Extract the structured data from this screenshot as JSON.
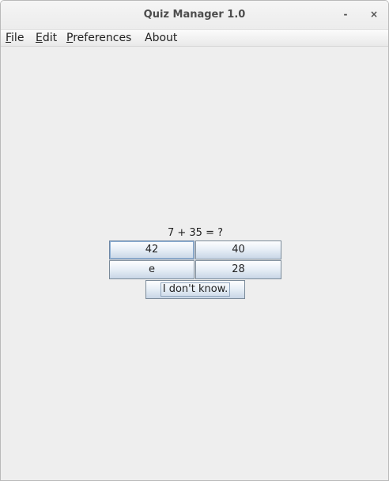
{
  "window": {
    "title": "Quiz Manager 1.0",
    "minimize_label": "-",
    "close_label": "×"
  },
  "menubar": {
    "file": {
      "mnemonic": "F",
      "rest": "ile"
    },
    "edit": {
      "mnemonic": "E",
      "rest": "dit"
    },
    "preferences": {
      "mnemonic": "P",
      "rest": "references"
    },
    "about": {
      "label": "About"
    }
  },
  "quiz": {
    "question": "7 + 35 = ?",
    "answers": [
      "42",
      "40",
      "e",
      "28"
    ],
    "dont_know_label": "I don't know."
  }
}
